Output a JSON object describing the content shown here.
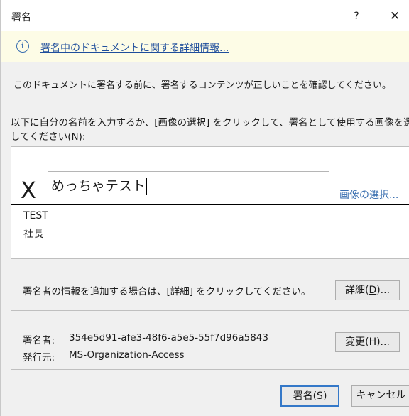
{
  "window": {
    "title": "署名",
    "help_glyph": "?",
    "close_glyph": "✕"
  },
  "infobar": {
    "icon_glyph": "i",
    "link_text": "署名中のドキュメントに関する詳細情報..."
  },
  "confirm": {
    "text": "このドキュメントに署名する前に、署名するコンテンツが正しいことを確認してください。"
  },
  "instruction": {
    "line1": "以下に自分の名前を入力するか、[画像の選択] をクリックして、署名として使用する画像を選択",
    "line2_prefix": "してください(",
    "line2_mnemonic": "N",
    "line2_suffix": "):"
  },
  "signature": {
    "x_mark": "X",
    "name_value": "めっちゃテスト",
    "select_image_link": "画像の選択...",
    "signer_name": "TEST",
    "signer_title": "社長"
  },
  "details": {
    "text": "署名者の情報を追加する場合は、[詳細] をクリックしてください。",
    "button_prefix": "詳細(",
    "button_mnemonic": "D",
    "button_suffix": ")..."
  },
  "signer_info": {
    "signer_label": "署名者:",
    "signer_value": "354e5d91-afe3-48f6-a5e5-55f7d96a5843",
    "issuer_label": "発行元:",
    "issuer_value": "MS-Organization-Access",
    "change_prefix": "変更(",
    "change_mnemonic": "H",
    "change_suffix": ")..."
  },
  "footer": {
    "sign_prefix": "署名(",
    "sign_mnemonic": "S",
    "sign_suffix": ")",
    "cancel_label": "キャンセル"
  },
  "colors": {
    "link": "#1f4e9c",
    "infobar_bg": "#fdfce6",
    "default_button_border": "#3478c8"
  }
}
